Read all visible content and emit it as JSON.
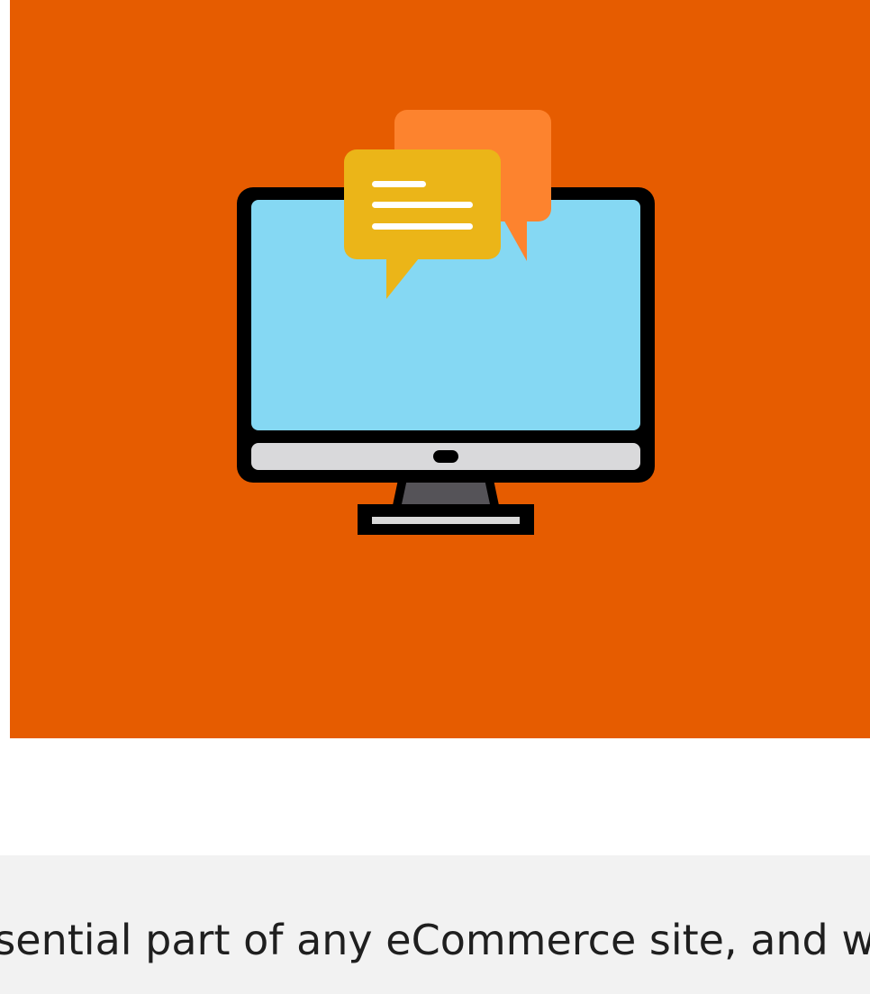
{
  "hero": {
    "background_color": "#e65c00",
    "illustration": {
      "monitor_icon": "desktop-monitor-icon",
      "chat_icon": "chat-bubbles-icon",
      "screen_color": "#85d8f3",
      "front_bubble_color": "#ebb518",
      "back_bubble_color": "#fd832e"
    }
  },
  "article": {
    "excerpt": "essential part of any eCommerce site, and w"
  }
}
